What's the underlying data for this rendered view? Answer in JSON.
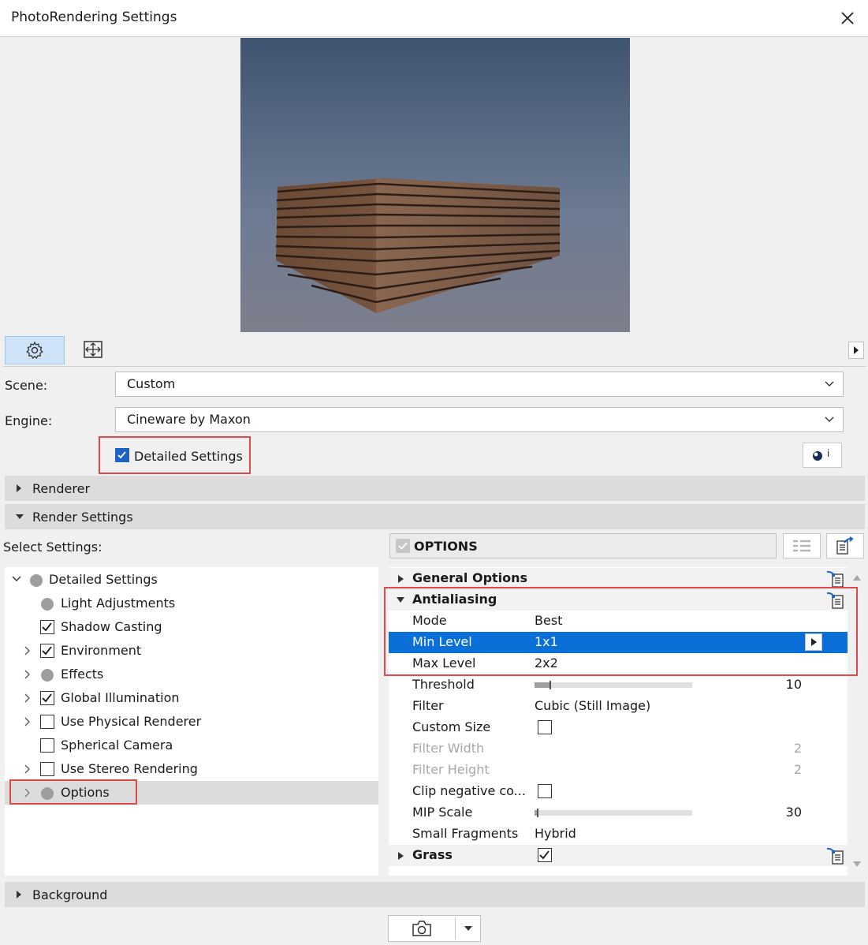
{
  "window": {
    "title": "PhotoRendering Settings"
  },
  "form": {
    "scene_label": "Scene:",
    "scene_value": "Custom",
    "engine_label": "Engine:",
    "engine_value": "Cineware by Maxon",
    "detailed_settings_label": "Detailed Settings",
    "detailed_settings_checked": true,
    "info_button_label": "i"
  },
  "sections": {
    "renderer": "Renderer",
    "render_settings": "Render Settings",
    "background": "Background"
  },
  "select_settings_label": "Select Settings:",
  "options_header": "OPTIONS",
  "tree": {
    "root": "Detailed Settings",
    "items": [
      {
        "label": "Light Adjustments",
        "kind": "dot"
      },
      {
        "label": "Shadow Casting",
        "kind": "checked"
      },
      {
        "label": "Environment",
        "kind": "checked"
      },
      {
        "label": "Effects",
        "kind": "dot"
      },
      {
        "label": "Global Illumination",
        "kind": "checked"
      },
      {
        "label": "Use Physical Renderer",
        "kind": "unchecked"
      },
      {
        "label": "Spherical Camera",
        "kind": "unchecked"
      },
      {
        "label": "Use Stereo Rendering",
        "kind": "unchecked"
      },
      {
        "label": "Options",
        "kind": "dot"
      }
    ]
  },
  "props": {
    "general_options": "General Options",
    "antialiasing": "Antialiasing",
    "mode_label": "Mode",
    "mode_value": "Best",
    "min_level_label": "Min Level",
    "min_level_value": "1x1",
    "max_level_label": "Max Level",
    "max_level_value": "2x2",
    "threshold_label": "Threshold",
    "threshold_value": "10",
    "filter_label": "Filter",
    "filter_value": "Cubic (Still Image)",
    "custom_size_label": "Custom Size",
    "filter_width_label": "Filter Width",
    "filter_width_value": "2",
    "filter_height_label": "Filter Height",
    "filter_height_value": "2",
    "clip_negative_label": "Clip negative co...",
    "mip_scale_label": "MIP Scale",
    "mip_scale_value": "30",
    "small_fragments_label": "Small Fragments",
    "small_fragments_value": "Hybrid",
    "grass_label": "Grass"
  },
  "colors": {
    "accent": "#0a6fd6",
    "highlight_red": "#e04a4a"
  }
}
